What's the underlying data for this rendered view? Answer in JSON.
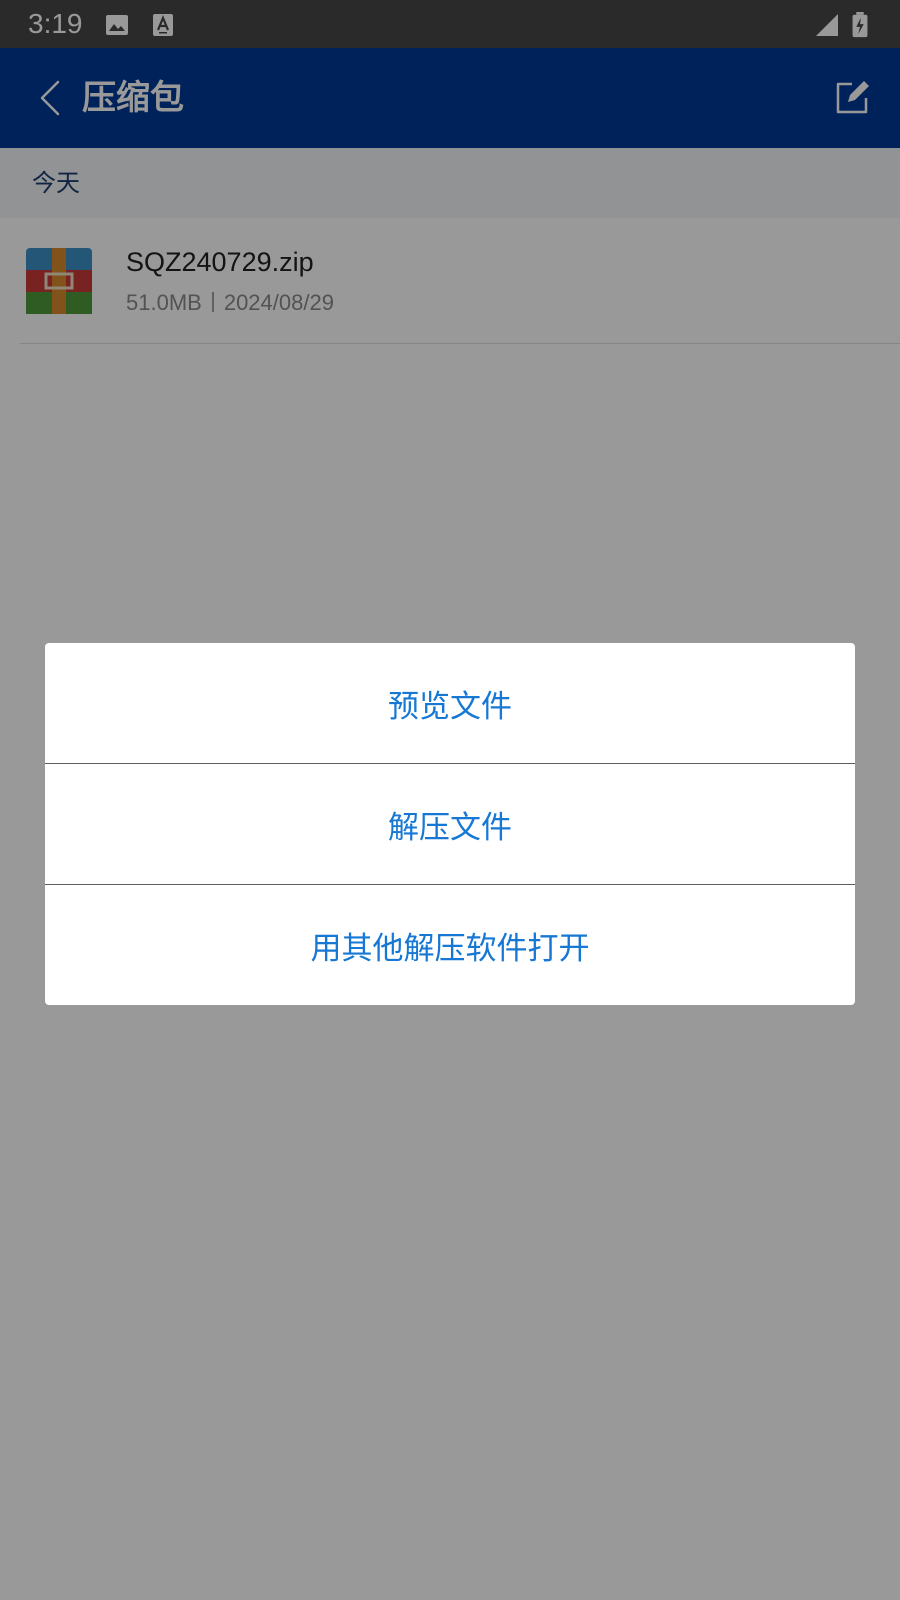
{
  "status_bar": {
    "time": "3:19",
    "icons": [
      "image-icon",
      "font-icon",
      "signal-icon",
      "battery-charging-icon"
    ]
  },
  "app_bar": {
    "title": "压缩包",
    "back_icon": "chevron-left-icon",
    "edit_icon": "edit-icon"
  },
  "section": {
    "label": "今天"
  },
  "files": [
    {
      "name": "SQZ240729.zip",
      "size": "51.0MB",
      "date": "2024/08/29",
      "icon": "zip-archive-icon"
    }
  ],
  "action_sheet": {
    "items": [
      {
        "label": "预览文件"
      },
      {
        "label": "解压文件"
      },
      {
        "label": "用其他解压软件打开"
      }
    ]
  },
  "colors": {
    "app_bar": "#003a96",
    "status_bar": "#474747",
    "action_text": "#1678d4",
    "overlay": "rgba(0,0,0,0.40)"
  }
}
